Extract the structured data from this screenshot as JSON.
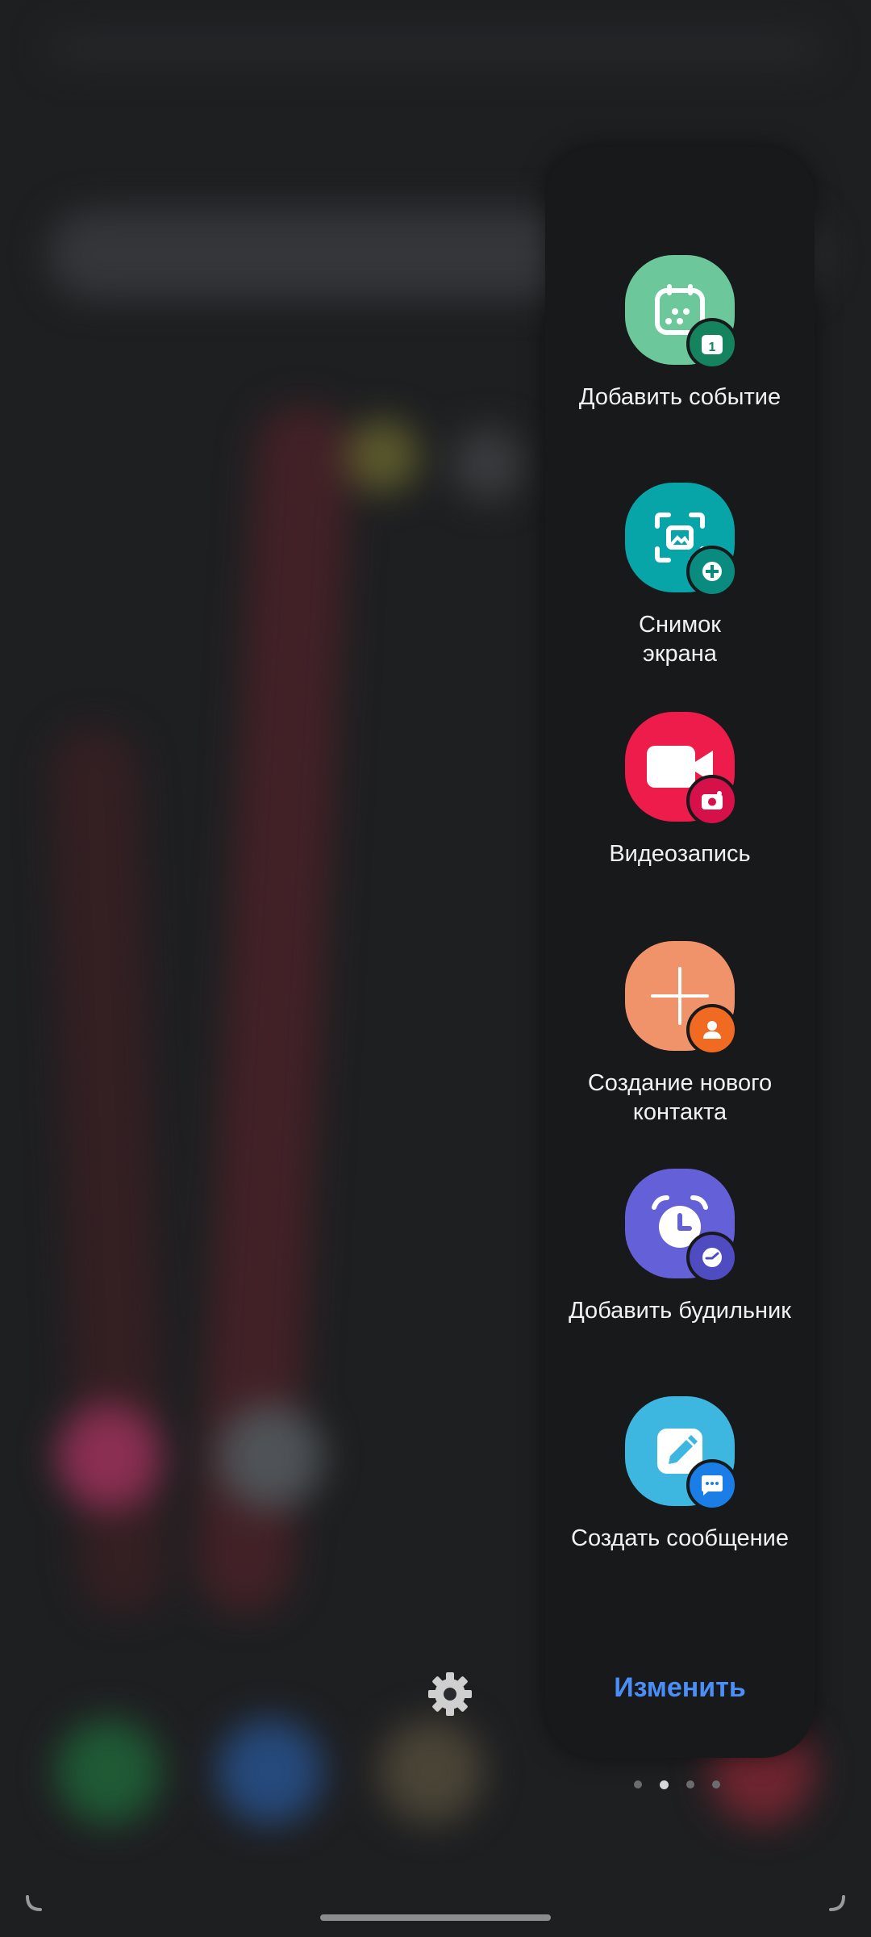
{
  "edge_panel": {
    "shortcuts": [
      {
        "label": "Добавить событие",
        "icon": "calendar-icon",
        "badge": "calendar-badge-icon",
        "color": "#6cc79b",
        "badge_color": "#15835e"
      },
      {
        "label": "Снимок\nэкрана",
        "icon": "screenshot-icon",
        "badge": "settings-badge-icon",
        "color": "#07a5a8",
        "badge_color": "#0a8b80"
      },
      {
        "label": "Видеозапись",
        "icon": "video-camera-icon",
        "badge": "camera-badge-icon",
        "color": "#ee1c4a",
        "badge_color": "#d6114a"
      },
      {
        "label": "Создание нового\nконтакта",
        "icon": "plus-icon",
        "badge": "person-badge-icon",
        "color": "#f0936a",
        "badge_color": "#f16a21"
      },
      {
        "label": "Добавить будильник",
        "icon": "alarm-clock-icon",
        "badge": "clock-badge-icon",
        "color": "#6461d8",
        "badge_color": "#4f4bc1"
      },
      {
        "label": "Создать сообщение",
        "icon": "pencil-icon",
        "badge": "message-badge-icon",
        "color": "#3eb7e0",
        "badge_color": "#1a7ee6"
      }
    ],
    "edit_label": "Изменить",
    "edit_color": "#4b8ef7"
  },
  "pagination": {
    "total": 4,
    "active": 1
  }
}
